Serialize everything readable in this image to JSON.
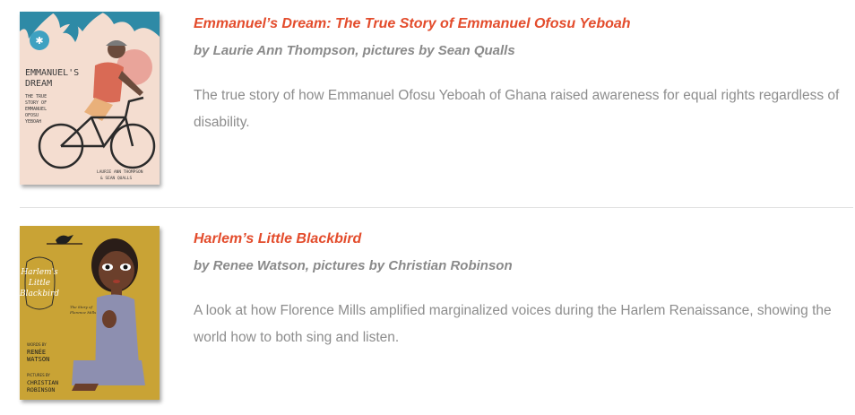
{
  "books": [
    {
      "title": "Emmanuel’s Dream: The True Story of Emmanuel Ofosu Yeboah",
      "byline": "by Laurie Ann Thompson, pictures by Sean Qualls",
      "description": "The true story of how Emmanuel Ofosu Yeboah of Ghana raised awareness for equal rights regardless of disability.",
      "cover": {
        "title_lines": [
          "EMMANUEL'S",
          "DREAM"
        ],
        "subtitle_lines": [
          "THE TRUE",
          "STORY OF",
          "EMMANUEL",
          "OFOSU",
          "YEBOAH"
        ],
        "credit_lines": [
          "LAURIE ANN THOMPSON",
          "& SEAN QUALLS"
        ]
      }
    },
    {
      "title": "Harlem’s Little Blackbird",
      "byline": "by Renee Watson, pictures by Christian Robinson",
      "description": "A look at how Florence Mills amplified marginalized voices during the Harlem Renaissance, showing the world how to both sing and listen.",
      "cover": {
        "title_lines": [
          "Harlem's",
          "Little",
          "Blackbird"
        ],
        "subtitle_lines": [
          "The Story of",
          "Florence Mills"
        ],
        "author_label": "WORDS BY",
        "author_lines": [
          "RENÉE",
          "WATSON"
        ],
        "illustrator_label": "PICTURES BY",
        "illustrator_lines": [
          "CHRISTIAN",
          "ROBINSON"
        ]
      }
    }
  ],
  "colors": {
    "title": "#e34c2c",
    "byline": "#8a8a8a",
    "description": "#8d8d8d",
    "divider": "#e3e3e3"
  }
}
